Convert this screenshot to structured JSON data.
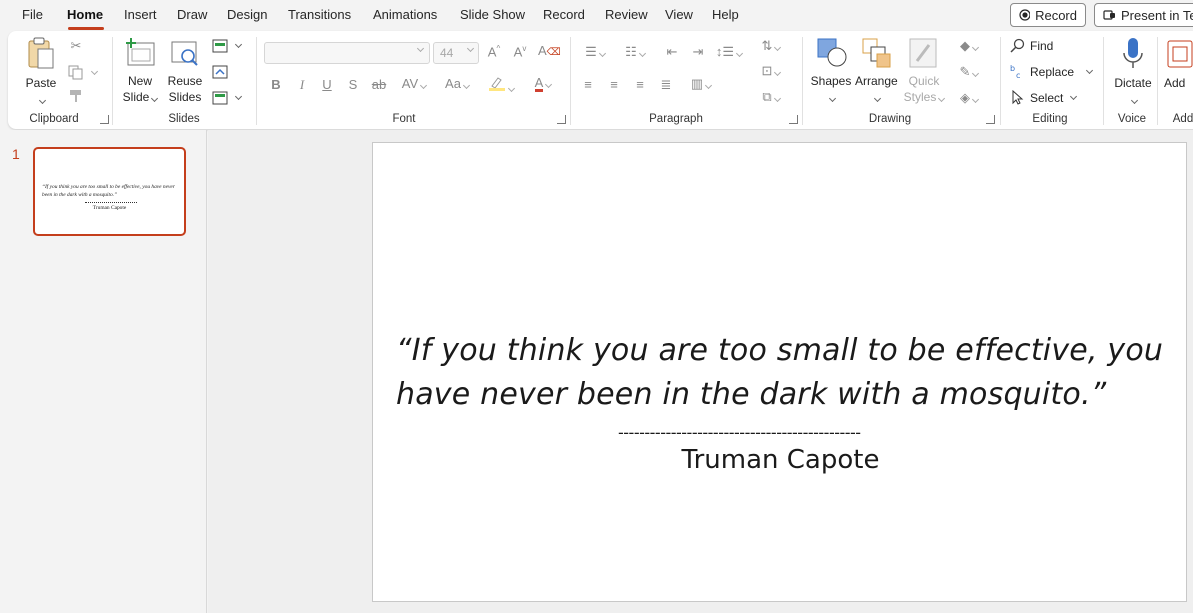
{
  "menu": {
    "tabs": [
      "File",
      "Home",
      "Insert",
      "Draw",
      "Design",
      "Transitions",
      "Animations",
      "Slide Show",
      "Record",
      "Review",
      "View",
      "Help"
    ],
    "active_tab": "Home",
    "record_button": "Record",
    "present_button": "Present in Te"
  },
  "ribbon": {
    "clipboard": {
      "group_label": "Clipboard",
      "paste": "Paste"
    },
    "slides": {
      "group_label": "Slides",
      "new_slide_line1": "New",
      "new_slide_line2": "Slide",
      "reuse_line1": "Reuse",
      "reuse_line2": "Slides"
    },
    "font": {
      "group_label": "Font",
      "font_name": "",
      "font_size": "44"
    },
    "paragraph": {
      "group_label": "Paragraph"
    },
    "drawing": {
      "group_label": "Drawing",
      "shapes": "Shapes",
      "arrange": "Arrange",
      "quick_styles_line1": "Quick",
      "quick_styles_line2": "Styles"
    },
    "editing": {
      "group_label": "Editing",
      "find": "Find",
      "replace": "Replace",
      "select": "Select"
    },
    "voice": {
      "group_label": "Voice",
      "dictate": "Dictate"
    },
    "addins": {
      "group_label": "Add",
      "button": "Add"
    }
  },
  "thumbnails": [
    {
      "number": "1",
      "quote": "“If you think you are too small to be effective, you have never been in the dark with a mosquito.”",
      "author": "Truman Capote"
    }
  ],
  "slide": {
    "quote": "“If you think you are too small to be effective, you have never been in the dark with a mosquito.”",
    "dashes": "----------------------------------------------",
    "author": "Truman Capote"
  },
  "colors": {
    "accent": "#c43e1c",
    "dictate_blue": "#3b73c6"
  }
}
